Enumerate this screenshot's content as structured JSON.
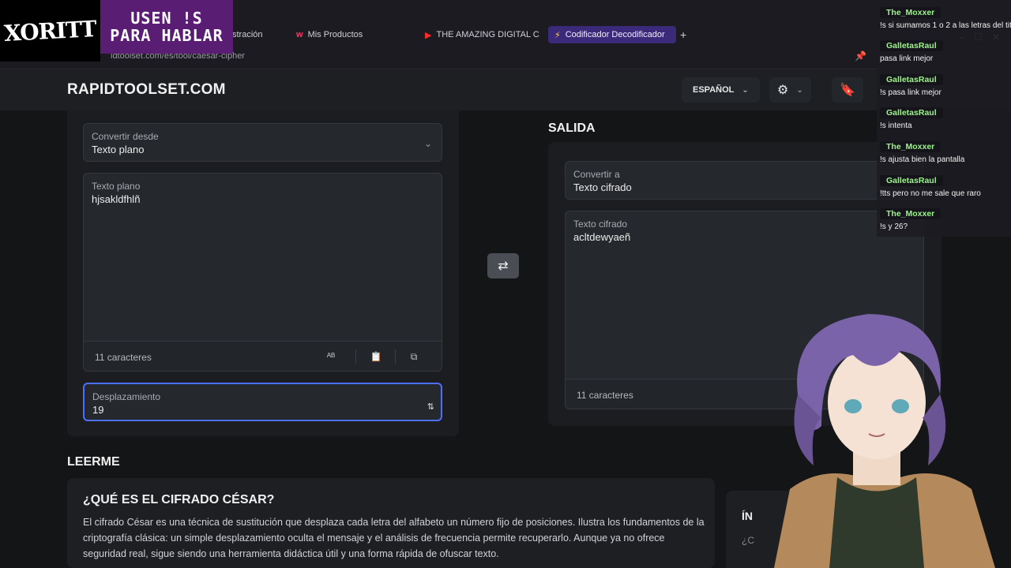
{
  "browser": {
    "tabs": [
      {
        "label": "inistración",
        "icon": ""
      },
      {
        "label": "Mis Productos",
        "icon": "w"
      },
      {
        "label": "THE AMAZING DIGITAL C",
        "icon": "▶"
      },
      {
        "label": "Codificador Decodificador",
        "icon": "⚡"
      }
    ],
    "new_tab_icon": "+",
    "url": "idtoolset.com/es/tool/caesar-cipher"
  },
  "overlay": {
    "logo": "XORITT",
    "notice_line1": "USEN !S",
    "notice_line2": "PARA HABLAR"
  },
  "site": {
    "brand": "RAPIDTOOLSET.COM",
    "language": "ESPAÑOL"
  },
  "input_panel": {
    "convert_from_label": "Convertir desde",
    "convert_from_value": "Texto plano",
    "text_label": "Texto plano",
    "text_value": "hjsakldfhlñ",
    "char_count": "11 caracteres",
    "shift_label": "Desplazamiento",
    "shift_value": "19"
  },
  "output_panel": {
    "heading": "SALIDA",
    "convert_to_label": "Convertir a",
    "convert_to_value": "Texto cifrado",
    "text_label": "Texto cifrado",
    "text_value": "acltdewyaeñ",
    "char_count": "11 caracteres"
  },
  "readme": {
    "heading": "LEERME",
    "title": "¿QUÉ ES EL CIFRADO CÉSAR?",
    "body": "El cifrado César es una técnica de sustitución que desplaza cada letra del alfabeto un número fijo de posiciones. Ilustra los fundamentos de la criptografía clásica: un simple desplazamiento oculta el mensaje y el análisis de frecuencia permite recuperarlo. Aunque ya no ofrece seguridad real, sigue siendo una herramienta didáctica útil y una forma rápida de ofuscar texto.",
    "side_title": "ÍN",
    "side_sub": "¿C"
  },
  "chat": [
    {
      "user": "The_Moxxer",
      "text": "!s si sumamos 1 o 2 a las letras del titu"
    },
    {
      "user": "GalletasRaul",
      "text": "pasa link mejor"
    },
    {
      "user": "GalletasRaul",
      "text": "!s pasa link mejor"
    },
    {
      "user": "GalletasRaul",
      "text": "!s intenta"
    },
    {
      "user": "The_Moxxer",
      "text": "!s ajusta bien la pantalla"
    },
    {
      "user": "GalletasRaul",
      "text": "!tts pero no me sale que raro"
    },
    {
      "user": "The_Moxxer",
      "text": "!s y 26?"
    }
  ],
  "colors": {
    "accent": "#4c6fff",
    "chat_user": "#9ef58c",
    "notice_bg": "#5a1d74"
  }
}
